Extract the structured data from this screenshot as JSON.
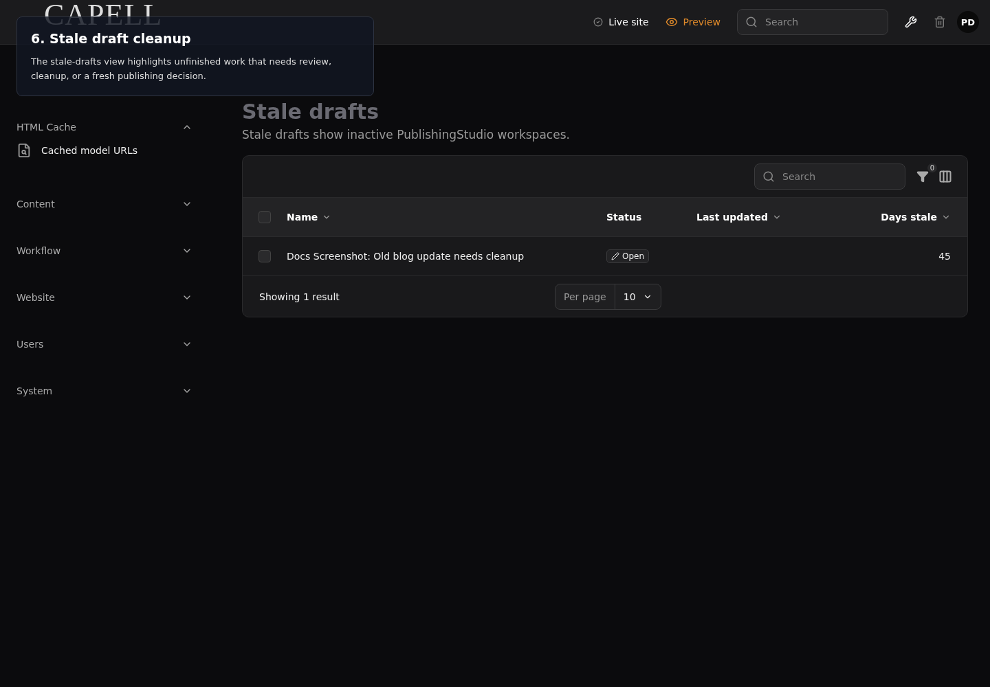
{
  "header": {
    "logo": "CAPELL",
    "live_site": "Live site",
    "preview": "Preview",
    "search": {
      "placeholder": "Search"
    },
    "avatar": "PD"
  },
  "tour": {
    "title": "6. Stale draft cleanup",
    "body": "The stale-drafts view highlights unfinished work that needs review, cleanup, or a fresh publishing decision."
  },
  "sidebar": {
    "groups": [
      {
        "label": "HTML Cache",
        "expanded": true,
        "items": [
          {
            "label": "Cached model URLs"
          }
        ]
      },
      {
        "label": "Content",
        "expanded": false
      },
      {
        "label": "Workflow",
        "expanded": false
      },
      {
        "label": "Website",
        "expanded": false
      },
      {
        "label": "Users",
        "expanded": false
      },
      {
        "label": "System",
        "expanded": false
      }
    ]
  },
  "page": {
    "title": "Stale drafts",
    "subtitle": "Stale drafts show inactive PublishingStudio workspaces."
  },
  "table": {
    "search": {
      "placeholder": "Search"
    },
    "filter_count": "0",
    "columns": [
      {
        "label": "Name",
        "sortable": true
      },
      {
        "label": "Status",
        "sortable": false
      },
      {
        "label": "Last updated",
        "sortable": true
      },
      {
        "label": "Days stale",
        "sortable": true
      }
    ],
    "rows": [
      {
        "checked": false,
        "name": "Docs Screenshot: Old blog update needs cleanup",
        "status": "Open",
        "days_stale": "45"
      }
    ],
    "select_all_checked": false,
    "footer": {
      "summary": "Showing 1 result",
      "per_page_label": "Per page",
      "per_page": "10"
    }
  }
}
